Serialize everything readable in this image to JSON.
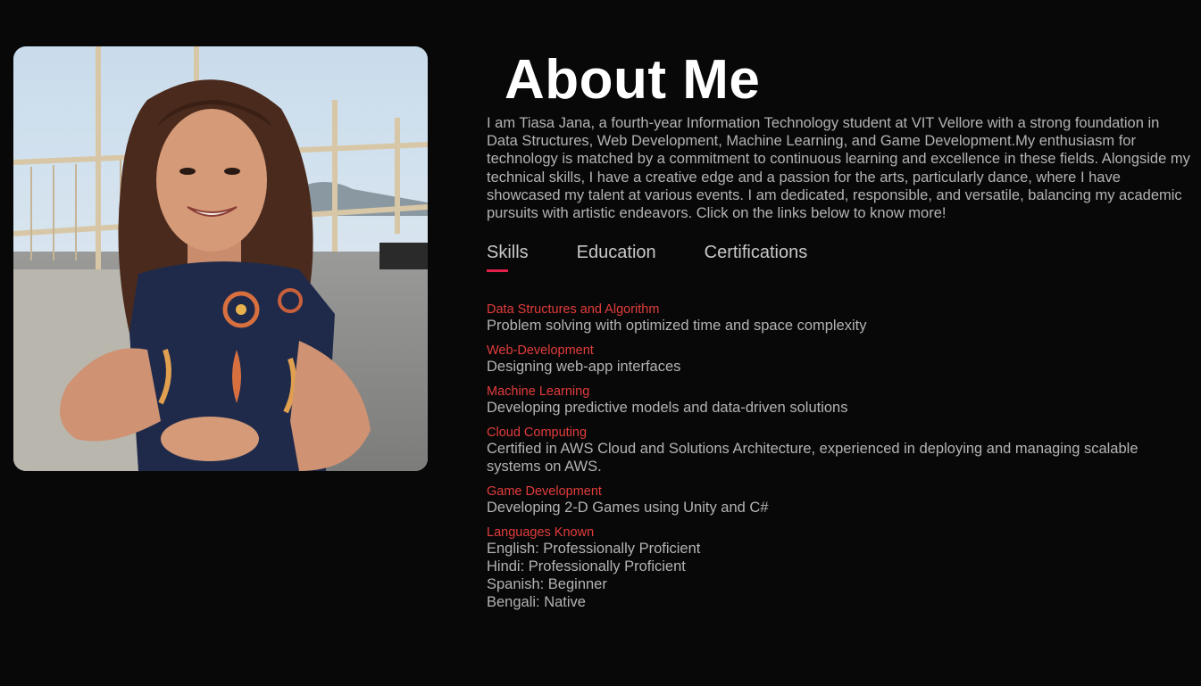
{
  "about": {
    "title": "About Me",
    "bio": "I am Tiasa Jana, a fourth-year Information Technology student at VIT Vellore with a strong foundation in Data Structures, Web Development, Machine Learning, and Game Development.My enthusiasm for technology is matched by a commitment to continuous learning and excellence in these fields. Alongside my technical skills, I have a creative edge and a passion for the arts, particularly dance, where I have showcased my talent at various events. I am dedicated, responsible, and versatile, balancing my academic pursuits with artistic endeavors. Click on the links below to know more!"
  },
  "tabs": [
    {
      "label": "Skills",
      "active": true
    },
    {
      "label": "Education",
      "active": false
    },
    {
      "label": "Certifications",
      "active": false
    }
  ],
  "skills": [
    {
      "name": "Data Structures and Algorithm",
      "desc": "Problem solving with optimized time and space complexity"
    },
    {
      "name": "Web-Development",
      "desc": "Designing web-app interfaces"
    },
    {
      "name": "Machine Learning",
      "desc": "Developing predictive models and data-driven solutions"
    },
    {
      "name": "Cloud Computing",
      "desc": "Certified in AWS Cloud and Solutions Architecture, experienced in deploying and managing scalable systems on AWS."
    },
    {
      "name": "Game Development",
      "desc": "Developing 2-D Games using Unity and C#"
    },
    {
      "name": "Languages Known",
      "lines": [
        "English: Professionally Proficient",
        "Hindi: Professionally Proficient",
        "Spanish: Beginner",
        "Bengali: Native"
      ]
    }
  ],
  "colors": {
    "background": "#080808",
    "accent": "#e3204a",
    "skill_name": "#e23c3c"
  }
}
